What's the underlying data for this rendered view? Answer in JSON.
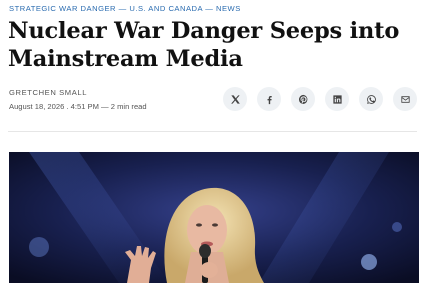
{
  "article": {
    "kicker": "STRATEGIC WAR DANGER — U.S. AND CANADA — NEWS",
    "title": "Nuclear War Danger Seeps into Mainstream Media",
    "author": "GRETCHEN SMALL",
    "meta": "August 18, 2026 . 4:51 PM — 2 min read"
  },
  "share": {
    "icons": [
      "x-icon",
      "facebook-icon",
      "pinterest-icon",
      "linkedin-icon",
      "whatsapp-icon",
      "email-icon"
    ]
  },
  "colors": {
    "kicker": "#2b6cb0",
    "share_bg": "#eef1f4",
    "hero_bg": "#0e1430"
  }
}
